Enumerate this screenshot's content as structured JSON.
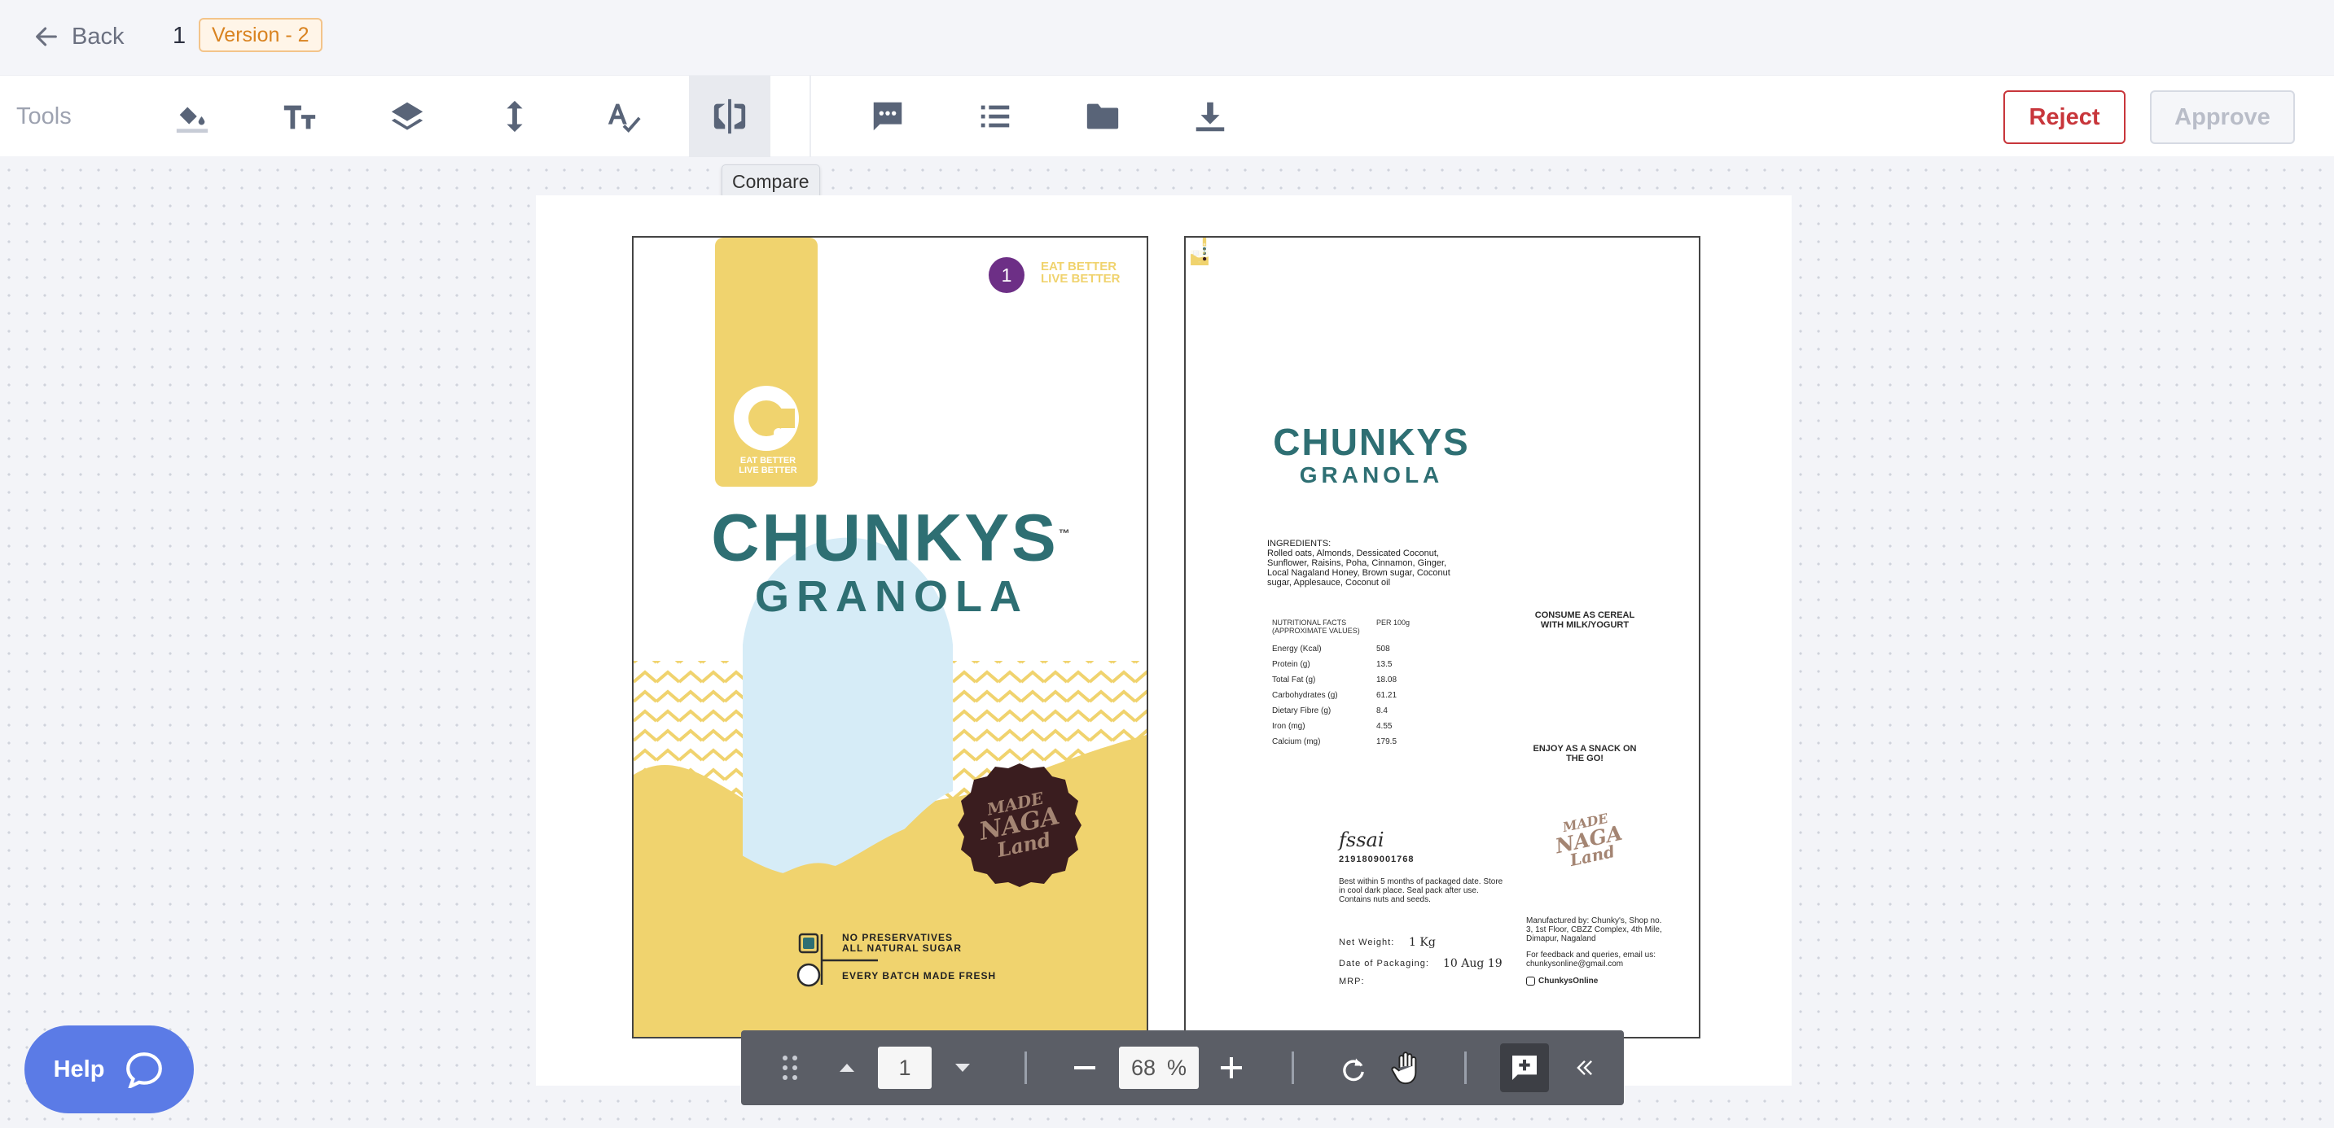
{
  "header": {
    "back_label": "Back",
    "version_number": "1",
    "version_badge": "Version - 2"
  },
  "toolbar": {
    "tools_label": "Tools",
    "tools": [
      {
        "name": "fill-icon"
      },
      {
        "name": "text-size-icon"
      },
      {
        "name": "layers-icon"
      },
      {
        "name": "vertical-resize-icon"
      },
      {
        "name": "spell-check-icon"
      },
      {
        "name": "compare-icon",
        "active": true
      }
    ],
    "secondary": [
      {
        "name": "comment-icon"
      },
      {
        "name": "list-icon"
      },
      {
        "name": "folder-icon"
      },
      {
        "name": "download-icon"
      }
    ],
    "reject_label": "Reject",
    "approve_label": "Approve",
    "tooltip": "Compare"
  },
  "artwork": {
    "annotation_number": "1",
    "front": {
      "brand": "CHUNKYS",
      "tm": "™",
      "product": "GRANOLA",
      "tagline_1": "EAT BETTER",
      "tagline_2": "LIVE BETTER",
      "seal_1": "MADE",
      "seal_2": "NAGA",
      "seal_3": "Land",
      "claim_1": "NO PRESERVATIVES",
      "claim_2": "ALL NATURAL SUGAR",
      "claim_3": "EVERY BATCH MADE FRESH"
    },
    "back": {
      "brand": "CHUNKYS",
      "product": "GRANOLA",
      "ingredients_title": "INGREDIENTS:",
      "ingredients_text": "Rolled oats, Almonds, Dessicated Coconut, Sunflower, Raisins, Poha, Cinnamon, Ginger, Local Nagaland Honey, Brown sugar, Coconut sugar, Applesauce, Coconut oil",
      "nutrition_header_1": "NUTRITIONAL FACTS (APPROXIMATE VALUES)",
      "nutrition_header_2": "PER 100g",
      "nutrition_rows": [
        {
          "label": "Energy (Kcal)",
          "value": "508"
        },
        {
          "label": "Protein (g)",
          "value": "13.5"
        },
        {
          "label": "Total Fat (g)",
          "value": "18.08"
        },
        {
          "label": "Carbohydrates (g)",
          "value": "61.21"
        },
        {
          "label": "Dietary Fibre (g)",
          "value": "8.4"
        },
        {
          "label": "Iron (mg)",
          "value": "4.55"
        },
        {
          "label": "Calcium (mg)",
          "value": "179.5"
        }
      ],
      "serve_1": "CONSUME AS CEREAL WITH MILK/YOGURT",
      "serve_2": "ENJOY AS A SNACK ON THE GO!",
      "fssai": "fssai",
      "fssai_no": "2191809001768",
      "storage": "Best within 5 months of packaged date. Store in cool dark place. Seal pack after use. Contains nuts and seeds.",
      "net_weight_label": "Net Weight:",
      "net_weight_value": "1 Kg",
      "pack_date_label": "Date of Packaging:",
      "pack_date_value": "10 Aug 19",
      "mrp_label": "MRP:",
      "manufacturer": "Manufactured by: Chunky's, Shop no. 3, 1st Floor, CBZZ Complex, 4th Mile, Dimapur, Nagaland",
      "feedback": "For feedback and queries, email us: chunkysonline@gmail.com",
      "instagram": "ChunkysOnline"
    }
  },
  "viewer": {
    "page": "1",
    "zoom": "68",
    "zoom_unit": "%"
  },
  "help_label": "Help",
  "colors": {
    "accent_yellow": "#f0d36e",
    "brand_teal": "#2e6f73",
    "reject_red": "#c8363b",
    "help_blue": "#5b7be6",
    "badge_orange": "#d98320"
  }
}
